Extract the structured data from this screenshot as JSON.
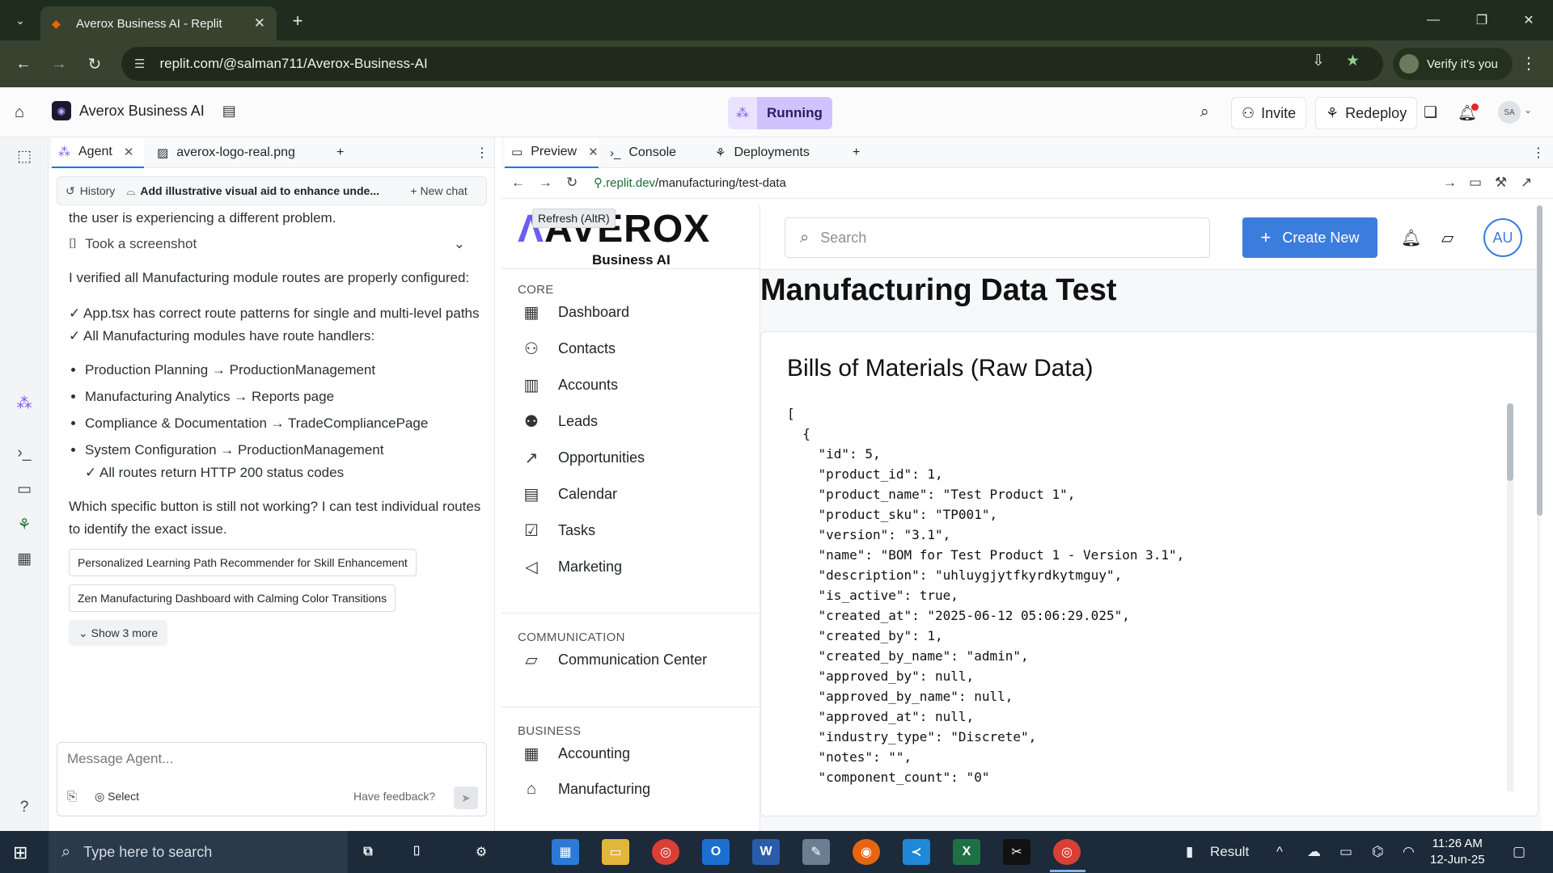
{
  "browser": {
    "tab_title": "Averox Business AI - Replit",
    "url": "replit.com/@salman711/Averox-Business-AI",
    "verify_label": "Verify it's you"
  },
  "replit": {
    "project_name": "Averox Business AI",
    "status": "Running",
    "invite_label": "Invite",
    "redeploy_label": "Redeploy",
    "user_initials": "SA"
  },
  "agent_panel": {
    "tabs": [
      {
        "label": "Agent"
      },
      {
        "label": "averox-logo-real.png"
      }
    ],
    "history_label": "History",
    "chat_title": "Add illustrative visual aid to enhance unde...",
    "new_chat_label": "New chat",
    "messages": {
      "line1": "the user is experiencing a different problem.",
      "screenshot": "Took a screenshot",
      "para1": "I verified all Manufacturing module routes are properly configured:",
      "check1": "✓ App.tsx has correct route patterns for single and multi-level paths",
      "check2": "✓ All Manufacturing modules have route handlers:",
      "bullets": [
        "Production Planning → ProductionManagement",
        "Manufacturing Analytics → Reports page",
        "Compliance & Documentation → TradeCompliancePage",
        "System Configuration → ProductionManagement"
      ],
      "check3": "✓ All routes return HTTP 200 status codes",
      "question": "Which specific button is still not working? I can test individual routes to identify the exact issue."
    },
    "suggestions": [
      "Personalized Learning Path Recommender for Skill Enhancement",
      "Zen Manufacturing Dashboard with Calming Color Transitions"
    ],
    "show_more": "Show 3 more",
    "input_placeholder": "Message Agent...",
    "select_label": "Select",
    "feedback_label": "Have feedback?"
  },
  "preview_panel": {
    "tabs": [
      {
        "label": "Preview"
      },
      {
        "label": "Console"
      },
      {
        "label": "Deployments"
      }
    ],
    "url_domain": ".replit.dev",
    "url_path": "/manufacturing/test-data",
    "tooltip": "Refresh (AltR)"
  },
  "app": {
    "brand_main": "AVEROX",
    "brand_sub": "Business AI",
    "sections": {
      "core": "CORE",
      "communication": "COMMUNICATION",
      "business": "BUSINESS"
    },
    "core_nav": [
      {
        "label": "Dashboard",
        "icon": "dashboard-icon"
      },
      {
        "label": "Contacts",
        "icon": "contacts-icon"
      },
      {
        "label": "Accounts",
        "icon": "accounts-icon"
      },
      {
        "label": "Leads",
        "icon": "leads-icon"
      },
      {
        "label": "Opportunities",
        "icon": "trend-icon"
      },
      {
        "label": "Calendar",
        "icon": "calendar-icon"
      },
      {
        "label": "Tasks",
        "icon": "tasks-icon"
      },
      {
        "label": "Marketing",
        "icon": "megaphone-icon"
      }
    ],
    "communication_nav": [
      {
        "label": "Communication Center",
        "icon": "chat-icon"
      }
    ],
    "business_nav": [
      {
        "label": "Accounting",
        "icon": "calculator-icon"
      },
      {
        "label": "Manufacturing",
        "icon": "factory-icon"
      }
    ],
    "search_placeholder": "Search",
    "create_new_label": "Create New",
    "avatar_initials": "AU",
    "page_title": "Manufacturing Data Test",
    "card_title": "Bills of Materials (Raw Data)",
    "raw_json_lines": [
      "[",
      "  {",
      "    \"id\": 5,",
      "    \"product_id\": 1,",
      "    \"product_name\": \"Test Product 1\",",
      "    \"product_sku\": \"TP001\",",
      "    \"version\": \"3.1\",",
      "    \"name\": \"BOM for Test Product 1 - Version 3.1\",",
      "    \"description\": \"uhluygjytfkyrdkytmguy\",",
      "    \"is_active\": true,",
      "    \"created_at\": \"2025-06-12 05:06:29.025\",",
      "    \"created_by\": 1,",
      "    \"created_by_name\": \"admin\",",
      "    \"approved_by\": null,",
      "    \"approved_by_name\": null,",
      "    \"approved_at\": null,",
      "    \"industry_type\": \"Discrete\",",
      "    \"notes\": \"\",",
      "    \"component_count\": \"0\""
    ]
  },
  "taskbar": {
    "search_placeholder": "Type here to search",
    "result_label": "Result",
    "time": "11:26 AM",
    "date": "12-Jun-25"
  },
  "colors": {
    "accent_blue": "#3b7ddd",
    "running_bg": "#cfc3ff",
    "chrome_dark": "#1f2d1e"
  }
}
